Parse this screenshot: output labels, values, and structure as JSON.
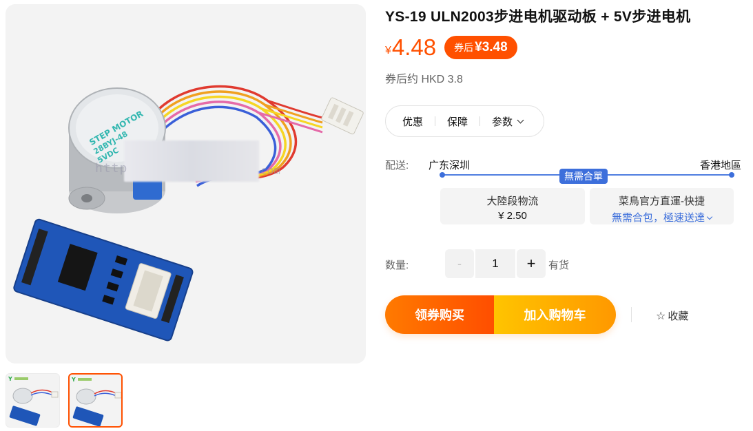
{
  "product": {
    "title": "YS-19 ULN2003步进电机驱动板 + 5V步进电机",
    "price_symbol": "¥",
    "price": "4.48",
    "coupon_prefix": "券后",
    "coupon_price": "¥3.48",
    "hkd_estimate": "券后约 HKD 3.8"
  },
  "tabs": [
    {
      "label": "优惠"
    },
    {
      "label": "保障"
    },
    {
      "label": "参数"
    }
  ],
  "shipping": {
    "label": "配送:",
    "from": "广东深圳",
    "to": "香港地區",
    "badge": "無需合單",
    "mainland": {
      "title": "大陸段物流",
      "fee": "¥ 2.50"
    },
    "official": {
      "title": "菜鳥官方直運-快捷",
      "desc": "無需合包，極速送達"
    }
  },
  "quantity": {
    "label": "数量:",
    "minus": "-",
    "value": "1",
    "plus": "+",
    "stock": "有货"
  },
  "actions": {
    "buy_now": "领券购买",
    "add_to_cart": "加入购物车",
    "favorite": "收藏"
  },
  "gallery": {
    "image_text_watermark": "http",
    "image_text_watermark_right": "com",
    "selected_thumbnail": 2
  },
  "colors": {
    "accent": "#ff5000",
    "route_blue": "#3d6fdb",
    "cart_yellow": "#ffc400"
  }
}
